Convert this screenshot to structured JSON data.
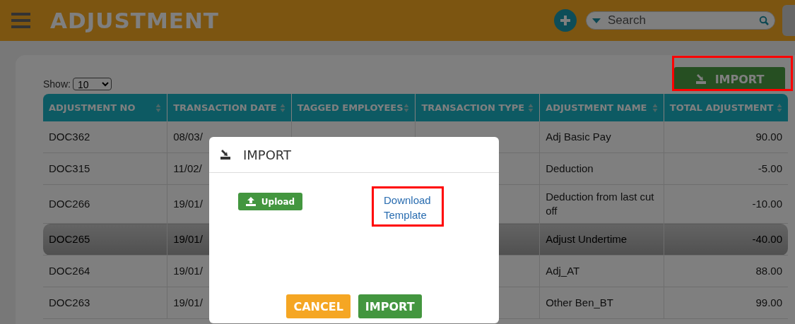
{
  "header": {
    "title": "ADJUSTMENT",
    "search": {
      "placeholder": "Search"
    }
  },
  "show": {
    "label": "Show:",
    "value": "10"
  },
  "import_button": {
    "label": "IMPORT",
    "highlighted": true
  },
  "table": {
    "columns": [
      "ADJUSTMENT NO",
      "TRANSACTION DATE",
      "TAGGED EMPLOYEES",
      "TRANSACTION TYPE",
      "ADJUSTMENT NAME",
      "TOTAL ADJUSTMENT"
    ],
    "rows": [
      {
        "selected": false,
        "no": "DOC362",
        "date": "08/03/",
        "name": "Adj Basic Pay",
        "total": "90.00"
      },
      {
        "selected": false,
        "no": "DOC315",
        "date": "11/02/",
        "name": "Deduction",
        "total": "-5.00"
      },
      {
        "selected": false,
        "no": "DOC266",
        "date": "19/01/",
        "name": "Deduction from last cut off",
        "total": "-10.00"
      },
      {
        "selected": true,
        "no": "DOC265",
        "date": "19/01/",
        "name": "Adjust Undertime",
        "total": "-40.00"
      },
      {
        "selected": false,
        "no": "DOC264",
        "date": "19/01/",
        "name": "Adj_AT",
        "total": "88.00"
      },
      {
        "selected": false,
        "no": "DOC263",
        "date": "19/01/",
        "name": "Other Ben_BT",
        "total": "99.00"
      }
    ]
  },
  "dialog": {
    "title": "IMPORT",
    "upload": "Upload",
    "download_link": {
      "label": "Download Template",
      "highlighted": true
    },
    "buttons": [
      {
        "label": "CANCEL",
        "kind": "cancel"
      },
      {
        "label": "IMPORT",
        "kind": "confirm"
      }
    ]
  }
}
